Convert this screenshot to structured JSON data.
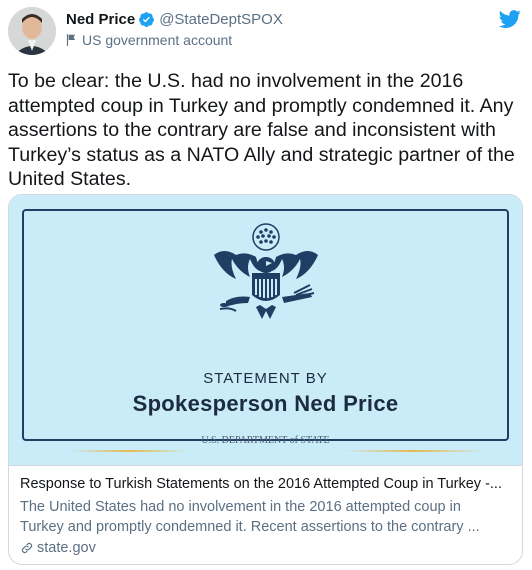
{
  "author": {
    "name": "Ned Price",
    "handle": "@StateDeptSPOX",
    "account_label": "US government account"
  },
  "tweet": {
    "text": "To be clear: the U.S. had no involvement in the 2016\nattempted coup in Turkey and promptly condemned it. Any\nassertions to the contrary are false and inconsistent with\nTurkey’s status as a NATO Ally and strategic partner of the\nUnited States."
  },
  "card": {
    "image": {
      "statement_by": "STATEMENT BY",
      "speaker": "Spokesperson Ned Price",
      "department": "U.S. DEPARTMENT of STATE"
    },
    "title": "Response to Turkish Statements on the 2016 Attempted Coup in Turkey -...",
    "description_line1": "The United States had no involvement in the 2016 attempted coup in",
    "description_line2": "Turkey and promptly condemned it.  Recent assertions to the contrary ...",
    "domain": "state.gov"
  },
  "colors": {
    "twitter_blue": "#1da1f2",
    "card_background": "#c9ecf8",
    "navy": "#1f3e64",
    "gold": "#e5b94f"
  },
  "icons": [
    "verified-badge-icon",
    "government-flag-icon",
    "twitter-bird-icon",
    "link-icon",
    "eagle-seal-icon"
  ]
}
